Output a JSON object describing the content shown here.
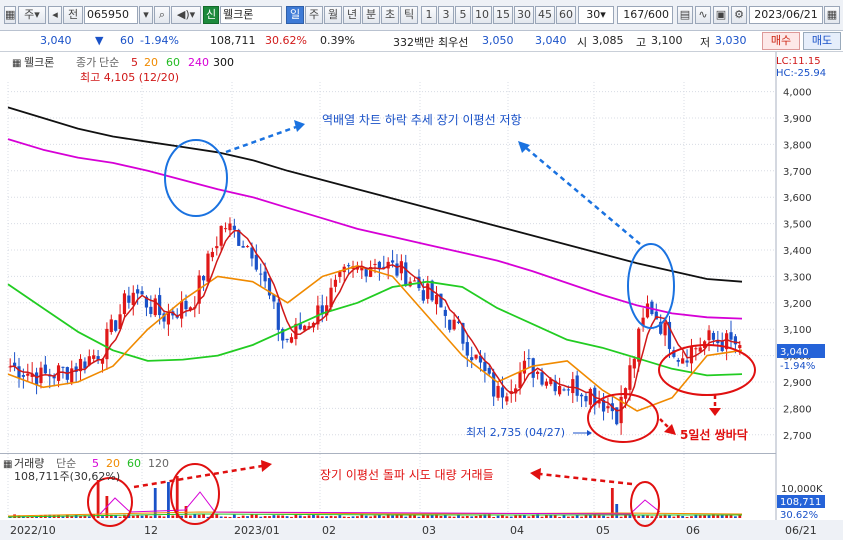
{
  "toolbar": {
    "period_label": "주",
    "prev_label": "전",
    "code": "065950",
    "badge": "신",
    "name": "웰크론",
    "intervals": [
      "일",
      "주",
      "월",
      "년",
      "분",
      "초",
      "틱"
    ],
    "active_interval": "일",
    "minutes": [
      "1",
      "3",
      "5",
      "10",
      "15",
      "30",
      "45",
      "60"
    ],
    "minute_select": "30",
    "count": "167/600",
    "date": "2023/06/21"
  },
  "quote": {
    "price": "3,040",
    "change": "60",
    "change_pct": "-1.94%",
    "volume": "108,711",
    "vol_ratio": "30.62%",
    "turnover": "0.39%",
    "amount": "332백만",
    "best_bid_label": "최우선",
    "best_ask": "3,050",
    "best_bid": "3,040",
    "open_label": "시",
    "open": "3,085",
    "high_label": "고",
    "high": "3,100",
    "low_label": "저",
    "low": "3,030",
    "buy_label": "매수",
    "sell_label": "매도"
  },
  "chart_data": {
    "type": "candlestick",
    "title": "웰크론",
    "legend": [
      "종가",
      "단순",
      "5",
      "20",
      "60",
      "240",
      "300"
    ],
    "top_right": [
      "LC:11.15",
      "HC:-25.94"
    ],
    "ylim": [
      2650,
      4150
    ],
    "yticks": [
      "4,000",
      "3,900",
      "3,800",
      "3,700",
      "3,600",
      "3,500",
      "3,400",
      "3,300",
      "3,200",
      "3,100",
      "3,000",
      "2,900",
      "2,800",
      "2,700"
    ],
    "ytick_values": [
      4000,
      3900,
      3800,
      3700,
      3600,
      3500,
      3400,
      3300,
      3200,
      3100,
      3000,
      2900,
      2800,
      2700
    ],
    "xticks": [
      "2022/10",
      "12",
      "2023/01",
      "02",
      "03",
      "04",
      "05",
      "06",
      "06/21"
    ],
    "current_price": "3,040",
    "current_value": 3040,
    "current_pct": "-1.94%",
    "high_annotation": "최고 4,105 (12/20)",
    "low_annotation": "최저 2,735 (04/27)",
    "annotations": [
      "역배열 차트 하락 추세 장기 이평선 저항",
      "5일선 쌍바닥",
      "장기 이평선 돌파 시도 대량 거래들"
    ],
    "ma300_values": [
      3940,
      3900,
      3860,
      3830,
      3810,
      3790,
      3770,
      3740,
      3700,
      3665,
      3630,
      3595,
      3560,
      3525,
      3490,
      3455,
      3420,
      3385,
      3350,
      3320,
      3290,
      3280
    ],
    "ma240_values": [
      3820,
      3780,
      3750,
      3730,
      3700,
      3665,
      3630,
      3600,
      3560,
      3520,
      3480,
      3450,
      3420,
      3390,
      3360,
      3320,
      3275,
      3230,
      3190,
      3160,
      3145,
      3140
    ],
    "ma60_values": [
      3270,
      3180,
      3090,
      3020,
      2980,
      2985,
      3000,
      3040,
      3100,
      3160,
      3200,
      3260,
      3280,
      3260,
      3180,
      3120,
      3060,
      3030,
      2990,
      2950,
      2925,
      2930
    ],
    "ma20_values": [
      2930,
      2880,
      2900,
      2960,
      3100,
      3210,
      3300,
      3280,
      3200,
      3300,
      3340,
      3300,
      3150,
      3000,
      2900,
      2960,
      2980,
      2870,
      2790,
      2840,
      3000,
      3020
    ],
    "close_values": [
      2960,
      2920,
      2950,
      3020,
      3250,
      3150,
      3200,
      3500,
      3400,
      3050,
      3150,
      3300,
      3360,
      3310,
      3200,
      3050,
      2850,
      2960,
      2900,
      2870,
      2780,
      3200,
      3000,
      3060,
      3040
    ]
  },
  "volume_panel": {
    "legend": [
      "거래량",
      "단순",
      "5",
      "20",
      "60",
      "120"
    ],
    "info": "108,711주(30,62%)",
    "yticks": [
      "10,000K"
    ],
    "current_volume": "108,711",
    "current_pct": "30.62%"
  }
}
